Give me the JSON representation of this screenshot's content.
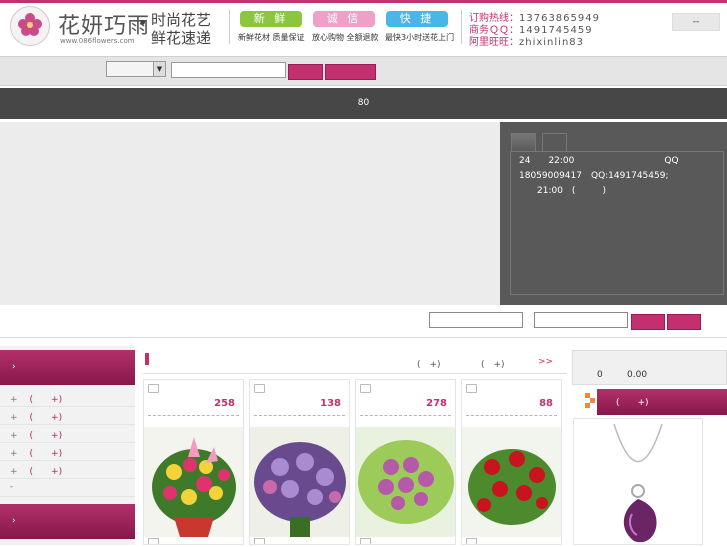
{
  "header": {
    "logo_text": "花妍巧雨",
    "logo_url": "www.086flowers.com",
    "dot": "•",
    "slogan_line1": "时尚花艺",
    "slogan_line2": "鲜花速递",
    "tags": [
      {
        "label": "新 鲜",
        "sub": "新鲜花材 质量保证",
        "color": "#8cc63f"
      },
      {
        "label": "诚 信",
        "sub": "放心购物 全额退款",
        "color": "#f0a0c8"
      },
      {
        "label": "快 捷",
        "sub": "最快3小时送花上门",
        "color": "#49b6e8"
      }
    ],
    "hotline_label": "订购热线：",
    "hotline_value": "13763865949",
    "qq_label": "商务ＱＱ：",
    "qq_value": "1491745459",
    "wangwang_label": "阿里旺旺：",
    "wangwang_value": "zhixinlin83",
    "lang_button": "--"
  },
  "search": {
    "select_value": "",
    "keyword": "",
    "button1": "",
    "button2": ""
  },
  "nav": {
    "text": "80"
  },
  "notice": {
    "line1": "24　　22:00　　　　　　　　　　QQ",
    "line2": "18059009417　QQ:1491745459;",
    "line3": "　　21:00　(　　　)"
  },
  "row2": {
    "input1": "",
    "input2": ""
  },
  "sidebar": {
    "heading1": "›",
    "heading2": "›",
    "items": [
      {
        "prefix": "+",
        "text": "(　　+)"
      },
      {
        "prefix": "+",
        "text": "(　　+)"
      },
      {
        "prefix": "+",
        "text": "(　　+)"
      },
      {
        "prefix": "+",
        "text": "(　　+)"
      },
      {
        "prefix": "+",
        "text": "(　　+)"
      },
      {
        "prefix": "-",
        "text": ""
      }
    ]
  },
  "products": {
    "link1": "(　+)",
    "link2": "(　+)",
    "more": ">>",
    "items": [
      {
        "price": "258",
        "name": "flower-bouquet-lily-roses"
      },
      {
        "price": "138",
        "name": "flower-bouquet-purple-roses"
      },
      {
        "price": "278",
        "name": "flower-bouquet-lavender-roses"
      },
      {
        "price": "88",
        "name": "flower-bouquet-red-roses"
      }
    ]
  },
  "right": {
    "count": "0",
    "amount": "0.00",
    "heading": "(　　+)"
  }
}
